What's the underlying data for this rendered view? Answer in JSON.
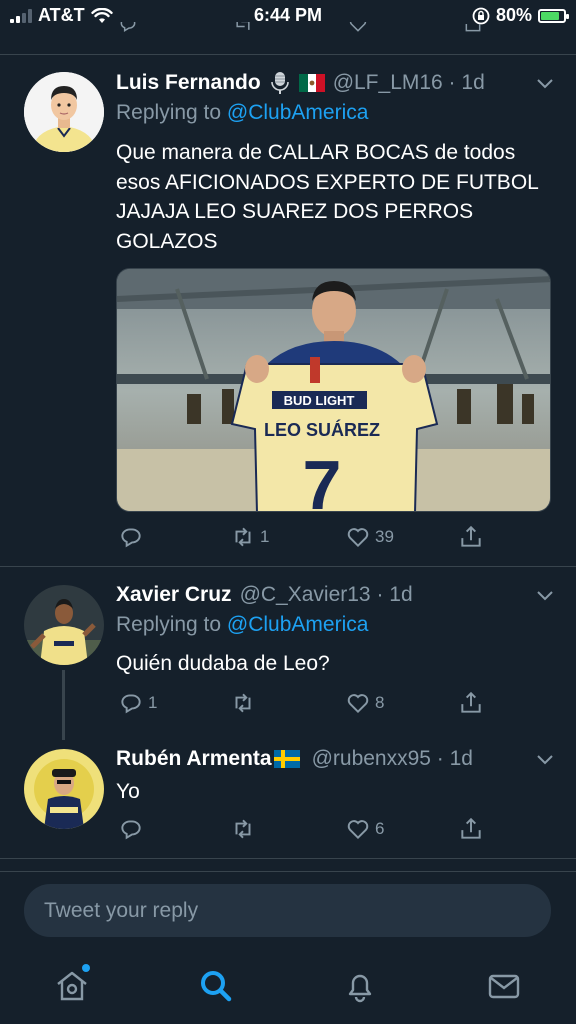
{
  "status_bar": {
    "carrier": "AT&T",
    "time": "6:44 PM",
    "battery_percent": "80%"
  },
  "tweets": [
    {
      "name": "Luis Fernando",
      "handle": "@LF_LM16 · 1d",
      "badges": [
        "microphone-icon",
        "mexico-flag"
      ],
      "replying_prefix": "Replying to ",
      "replying_to": "@ClubAmerica",
      "text": "Que manera de CALLAR BOCAS de todos esos AFICIONADOS EXPERTO DE FUTBOL JAJAJA LEO SUAREZ DOS PERROS GOLAZOS",
      "media": {
        "jersey_sponsor": "BUD LIGHT",
        "jersey_name": "LEO SUÁREZ",
        "jersey_number": "7"
      },
      "reply_count": "",
      "retweet_count": "1",
      "like_count": "39"
    },
    {
      "name": "Xavier Cruz",
      "handle": "@C_Xavier13 · 1d",
      "replying_prefix": "Replying to ",
      "replying_to": "@ClubAmerica",
      "text": "Quién dudaba de Leo?",
      "reply_count": "1",
      "retweet_count": "",
      "like_count": "8"
    },
    {
      "name": "Rubén Armenta",
      "badges": [
        "sweden-flag"
      ],
      "handle": "@rubenxx95 · 1d",
      "text": "Yo",
      "reply_count": "",
      "retweet_count": "",
      "like_count": "6"
    }
  ],
  "reply_box": {
    "placeholder": "Tweet your reply"
  },
  "bottom_nav": [
    "home-icon",
    "search-icon",
    "notifications-icon",
    "messages-icon"
  ],
  "colors": {
    "background": "#15202b",
    "accent": "#1da1f2",
    "muted": "#8899a6",
    "divider": "#38444d"
  }
}
